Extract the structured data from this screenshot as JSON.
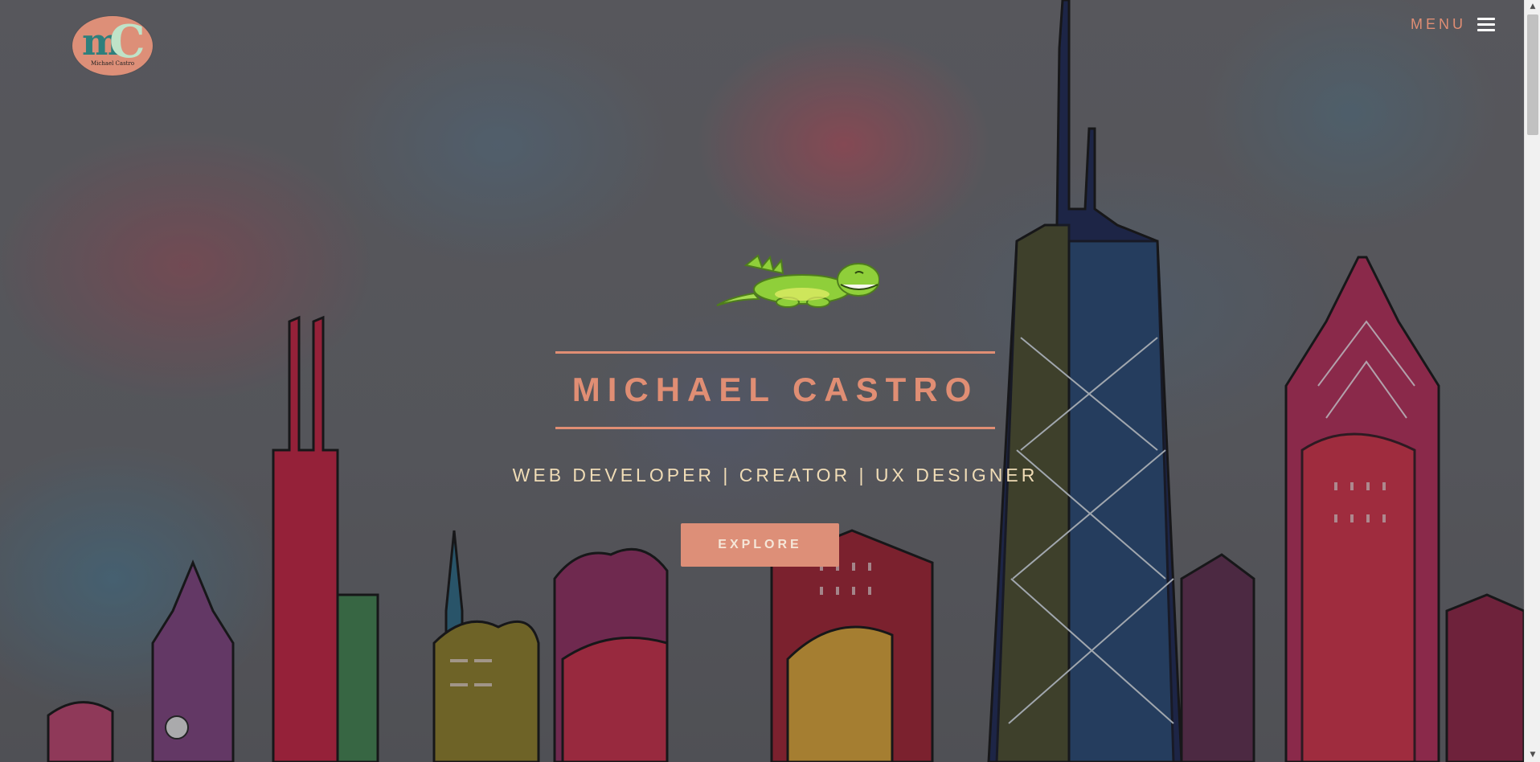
{
  "header": {
    "logo": {
      "initial_m": "m",
      "initial_c": "C",
      "name": "Michael Castro"
    },
    "menu_label": "MENU",
    "menu_icon": "hamburger-icon"
  },
  "hero": {
    "mascot_icon": "green-dinosaur-icon",
    "title": "MICHAEL CASTRO",
    "subtitle": "WEB DEVELOPER | CREATOR | UX DESIGNER",
    "cta_label": "EXPLORE"
  },
  "colors": {
    "accent": "#e08e74",
    "subtitle": "#f0dcb6",
    "button_bg": "#dd8f78",
    "logo_m": "#2e7f7c",
    "logo_c": "#bfe3c8"
  },
  "scrollbar": {
    "up_icon": "scroll-up-arrow-icon",
    "down_icon": "scroll-down-arrow-icon"
  }
}
